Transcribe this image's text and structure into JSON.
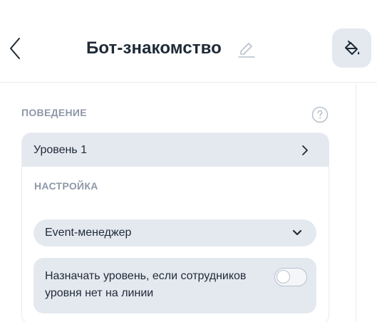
{
  "header": {
    "title": "Бот-знакомство",
    "back_icon": "chevron-left-icon",
    "edit_icon": "pencil-icon",
    "tool_icon": "paint-bucket-icon"
  },
  "behavior": {
    "section_label": "ПОВЕДЕНИЕ",
    "help_icon": "question-circle-icon",
    "level": {
      "label": "Уровень 1",
      "icon": "chevron-right-icon"
    },
    "settings": {
      "section_label": "НАСТРОЙКА",
      "select": {
        "value": "Event-менеджер",
        "icon": "chevron-down-icon"
      },
      "toggle": {
        "label": "Назначать уровень, если сотрудников уровня нет на линии",
        "enabled": false
      }
    }
  },
  "colors": {
    "text": "#1f2a37",
    "muted": "#8e98a7",
    "surface": "#e4e9f0",
    "border": "#e7ebf1"
  }
}
